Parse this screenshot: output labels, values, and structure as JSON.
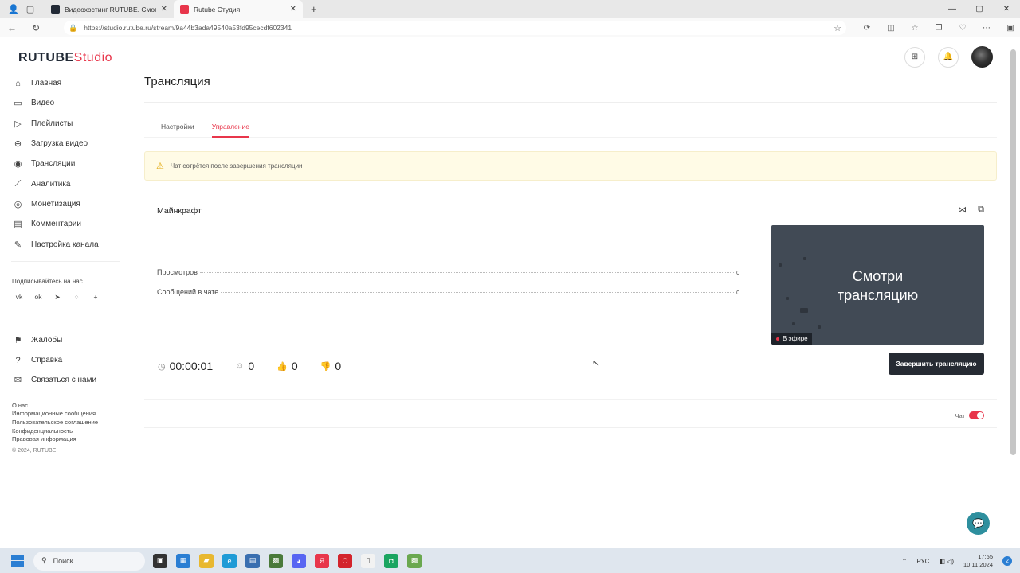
{
  "browser": {
    "tabs": [
      {
        "title": "Видеохостинг RUTUBE. Смотрите",
        "active": false
      },
      {
        "title": "Rutube Студия",
        "active": true
      }
    ],
    "url": "https://studio.rutube.ru/stream/9a44b3ada49540a53fd95cecdf602341"
  },
  "logo": {
    "brand": "RUTUBE",
    "suffix": "Studio"
  },
  "sidebar": {
    "items": [
      {
        "label": "Главная",
        "icon": "home-icon"
      },
      {
        "label": "Видео",
        "icon": "video-icon"
      },
      {
        "label": "Плейлисты",
        "icon": "playlist-icon"
      },
      {
        "label": "Загрузка видео",
        "icon": "upload-icon"
      },
      {
        "label": "Трансляции",
        "icon": "broadcast-icon"
      },
      {
        "label": "Аналитика",
        "icon": "analytics-icon"
      },
      {
        "label": "Монетизация",
        "icon": "monetization-icon"
      },
      {
        "label": "Комментарии",
        "icon": "comments-icon"
      },
      {
        "label": "Настройка канала",
        "icon": "channel-settings-icon"
      }
    ],
    "follow_label": "Подписывайтесь на нас",
    "socials": [
      "vk",
      "ok",
      "tg",
      "viber",
      "+"
    ],
    "support_items": [
      {
        "label": "Жалобы",
        "icon": "flag-icon"
      },
      {
        "label": "Справка",
        "icon": "help-icon"
      },
      {
        "label": "Связаться с нами",
        "icon": "contact-icon"
      }
    ],
    "footer_links": [
      "О нас",
      "Информационные сообщения",
      "Пользовательское соглашение",
      "Конфиденциальность",
      "Правовая информация"
    ],
    "copyright": "© 2024, RUTUBE"
  },
  "page": {
    "title": "Трансляция",
    "tabs": [
      {
        "label": "Настройки",
        "active": false
      },
      {
        "label": "Управление",
        "active": true
      }
    ],
    "notice": "Чат сотрётся после завершения трансляции",
    "stream": {
      "name": "Майнкрафт",
      "stats": [
        {
          "label": "Просмотров",
          "value": "0"
        },
        {
          "label": "Сообщений в чате",
          "value": "0"
        }
      ],
      "preview_line1": "Смотри",
      "preview_line2": "трансляцию",
      "live_label": "В эфире",
      "duration": "00:00:01",
      "viewers": "0",
      "likes": "0",
      "dislikes": "0",
      "end_button": "Завершить трансляцию"
    },
    "chat": {
      "label": "Чат",
      "enabled": true
    }
  },
  "taskbar": {
    "search_placeholder": "Поиск",
    "language": "РУС",
    "time": "17:55",
    "date": "10.11.2024",
    "notifications": "2"
  },
  "colors": {
    "accent": "#e8364b",
    "dark": "#262b33",
    "teal": "#2e8f9e",
    "notice_bg": "#fffbe6"
  }
}
